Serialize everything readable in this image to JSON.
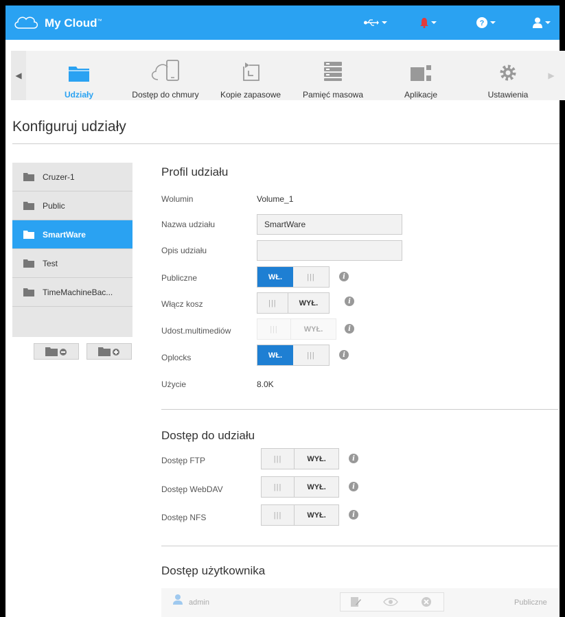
{
  "header": {
    "brand": "My Cloud",
    "brand_tm": "™"
  },
  "nav": {
    "items": [
      {
        "label": "Udziały"
      },
      {
        "label": "Dostęp do chmury"
      },
      {
        "label": "Kopie zapasowe"
      },
      {
        "label": "Pamięć masowa"
      },
      {
        "label": "Aplikacje"
      },
      {
        "label": "Ustawienia"
      }
    ]
  },
  "page": {
    "title": "Konfiguruj udziały"
  },
  "shares": {
    "items": [
      {
        "label": "Cruzer-1"
      },
      {
        "label": "Public"
      },
      {
        "label": "SmartWare"
      },
      {
        "label": "Test"
      },
      {
        "label": "TimeMachineBac..."
      }
    ],
    "selected": "SmartWare"
  },
  "profile": {
    "title": "Profil udziału",
    "volume_label": "Wolumin",
    "volume_value": "Volume_1",
    "name_label": "Nazwa udziału",
    "name_value": "SmartWare",
    "desc_label": "Opis udziału",
    "desc_value": "",
    "public_label": "Publiczne",
    "recycle_label": "Włącz kosz",
    "media_label": "Udost.multimediów",
    "oplocks_label": "Oplocks",
    "usage_label": "Użycie",
    "usage_value": "8.0K"
  },
  "toggle": {
    "on": "WŁ.",
    "off": "WYŁ.",
    "bars": "|||"
  },
  "access": {
    "title": "Dostęp do udziału",
    "ftp_label": "Dostęp FTP",
    "webdav_label": "Dostęp WebDAV",
    "nfs_label": "Dostęp NFS"
  },
  "user_access": {
    "title": "Dostęp użytkownika",
    "user": "admin",
    "access_level": "Publiczne"
  },
  "colors": {
    "accent": "#2aa2f2",
    "toggle_on": "#1e7fd3",
    "alert": "#e23b3b"
  }
}
